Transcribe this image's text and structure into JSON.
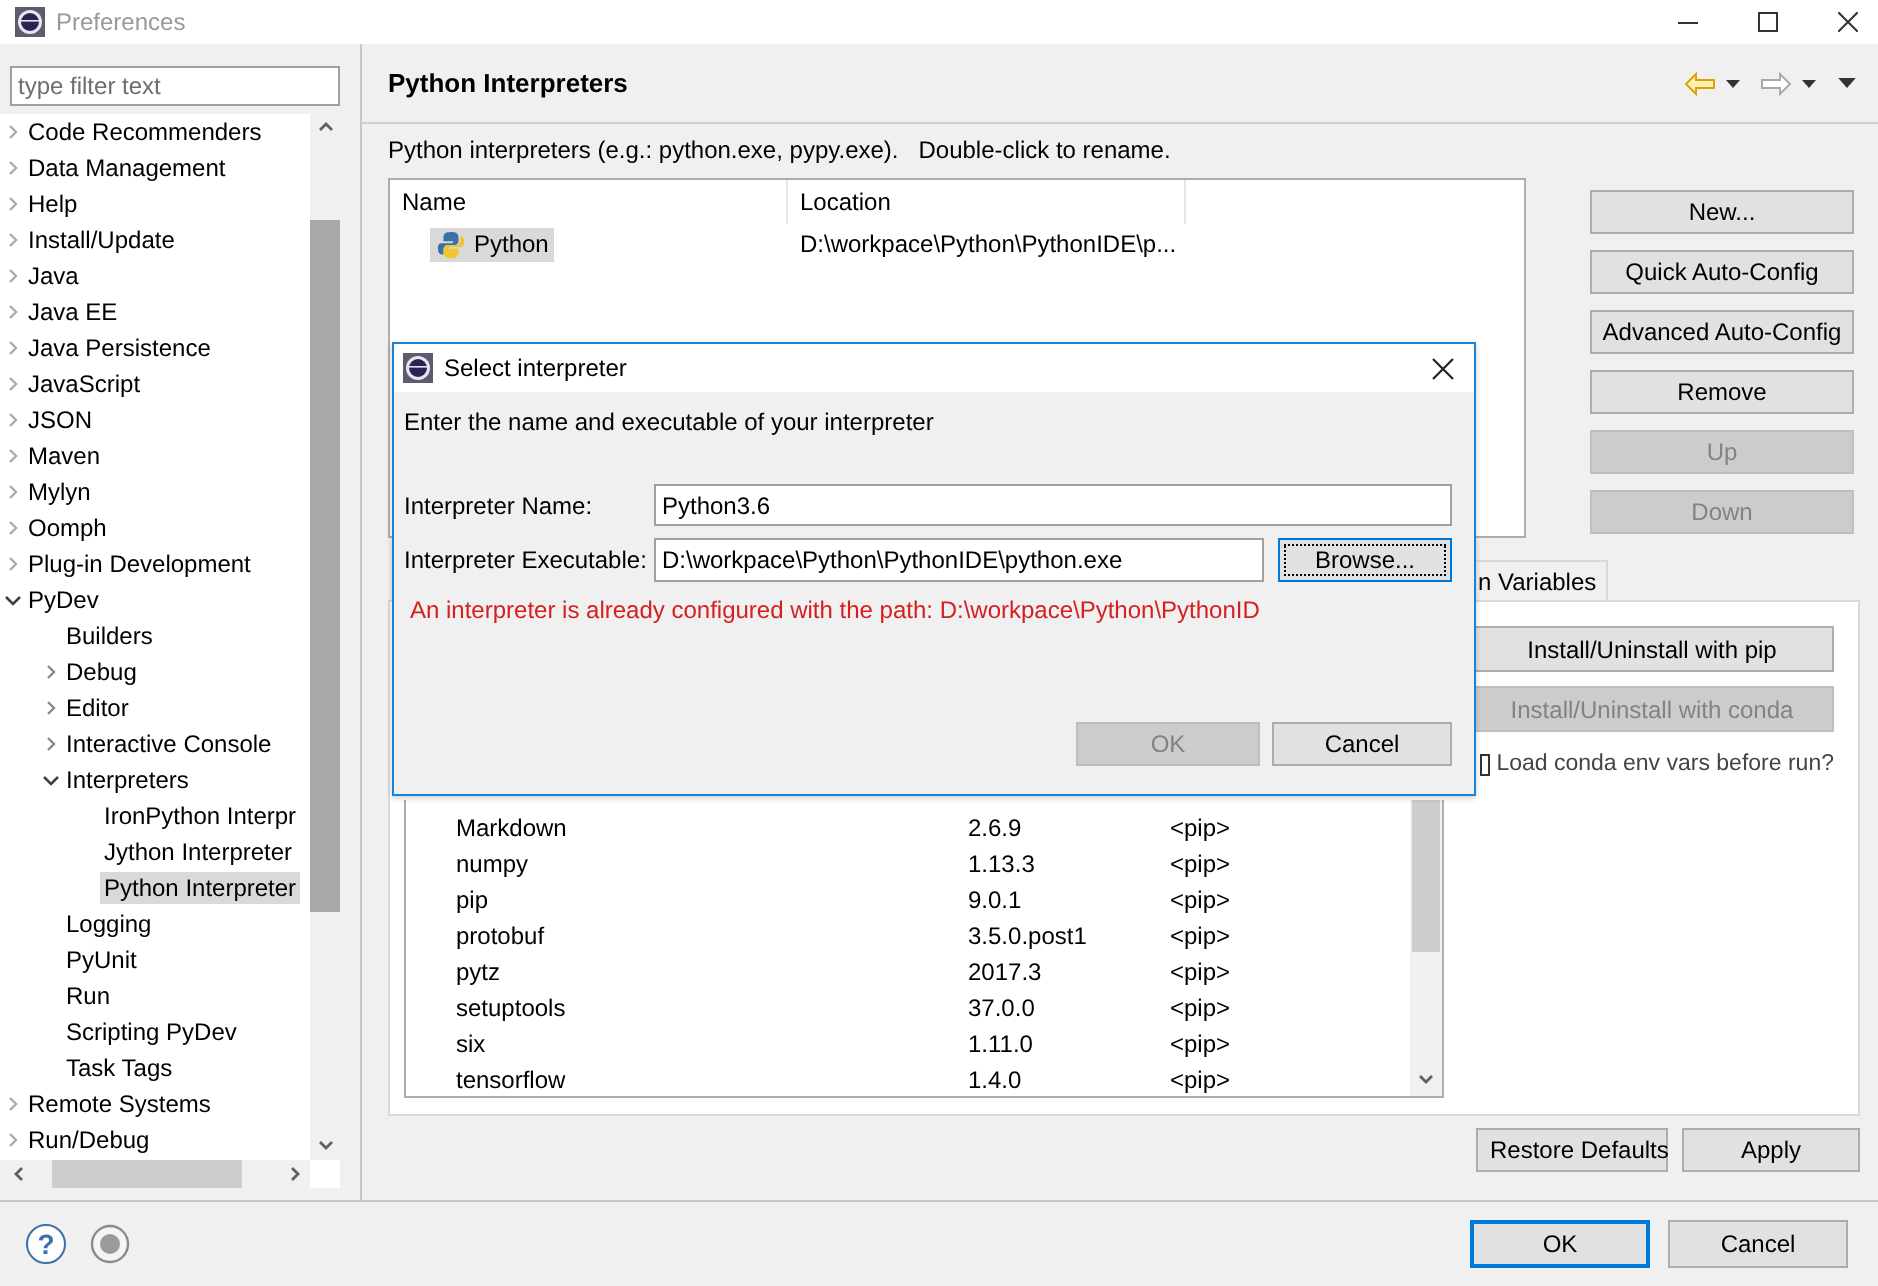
{
  "window": {
    "title": "Preferences"
  },
  "filter": {
    "placeholder": "type filter text"
  },
  "tree": [
    {
      "label": "Code Recommenders",
      "expanded": false,
      "selected": false
    },
    {
      "label": "Data Management",
      "expanded": false,
      "selected": false
    },
    {
      "label": "Help",
      "expanded": false,
      "selected": false
    },
    {
      "label": "Install/Update",
      "expanded": false,
      "selected": false
    },
    {
      "label": "Java",
      "expanded": false,
      "selected": false
    },
    {
      "label": "Java EE",
      "expanded": false,
      "selected": false
    },
    {
      "label": "Java Persistence",
      "expanded": false,
      "selected": false
    },
    {
      "label": "JavaScript",
      "expanded": false,
      "selected": false
    },
    {
      "label": "JSON",
      "expanded": false,
      "selected": false
    },
    {
      "label": "Maven",
      "expanded": false,
      "selected": false
    },
    {
      "label": "Mylyn",
      "expanded": false,
      "selected": false
    },
    {
      "label": "Oomph",
      "expanded": false,
      "selected": false
    },
    {
      "label": "Plug-in Development",
      "expanded": false,
      "selected": false
    },
    {
      "label": "PyDev",
      "expanded": true,
      "selected": false,
      "children": [
        {
          "label": "Builders",
          "selected": false
        },
        {
          "label": "Debug",
          "expanded": false,
          "selected": false
        },
        {
          "label": "Editor",
          "expanded": false,
          "selected": false
        },
        {
          "label": "Interactive Console",
          "expanded": false,
          "selected": false
        },
        {
          "label": "Interpreters",
          "expanded": true,
          "selected": false,
          "children": [
            {
              "label": "IronPython Interpr",
              "selected": false
            },
            {
              "label": "Jython Interpreter",
              "selected": false
            },
            {
              "label": "Python Interpreter",
              "selected": true
            }
          ]
        },
        {
          "label": "Logging",
          "selected": false
        },
        {
          "label": "PyUnit",
          "selected": false
        },
        {
          "label": "Run",
          "selected": false
        },
        {
          "label": "Scripting PyDev",
          "selected": false
        },
        {
          "label": "Task Tags",
          "selected": false
        }
      ]
    },
    {
      "label": "Remote Systems",
      "expanded": false,
      "selected": false
    },
    {
      "label": "Run/Debug",
      "expanded": false,
      "selected": false
    }
  ],
  "page": {
    "title": "Python Interpreters",
    "description": "Python interpreters (e.g.: python.exe, pypy.exe).   Double-click to rename."
  },
  "interpreters": {
    "columns": [
      "Name",
      "Location"
    ],
    "rows": [
      {
        "name": "Python",
        "location": "D:\\workpace\\Python\\PythonIDE\\p...",
        "selected": true
      }
    ]
  },
  "side_buttons": [
    {
      "label": "New...",
      "disabled": false
    },
    {
      "label": "Quick Auto-Config",
      "disabled": false
    },
    {
      "label": "Advanced Auto-Config",
      "disabled": false
    },
    {
      "label": "Remove",
      "disabled": false
    },
    {
      "label": "Up",
      "disabled": true
    },
    {
      "label": "Down",
      "disabled": true
    }
  ],
  "tabs": [
    {
      "label": "n Variables",
      "selected": false
    }
  ],
  "packages": [
    {
      "name": "Markdown",
      "version": "2.6.9",
      "source": "<pip>"
    },
    {
      "name": "numpy",
      "version": "1.13.3",
      "source": "<pip>"
    },
    {
      "name": "pip",
      "version": "9.0.1",
      "source": "<pip>"
    },
    {
      "name": "protobuf",
      "version": "3.5.0.post1",
      "source": "<pip>"
    },
    {
      "name": "pytz",
      "version": "2017.3",
      "source": "<pip>"
    },
    {
      "name": "setuptools",
      "version": "37.0.0",
      "source": "<pip>"
    },
    {
      "name": "six",
      "version": "1.11.0",
      "source": "<pip>"
    },
    {
      "name": "tensorflow",
      "version": "1.4.0",
      "source": "<pip>"
    }
  ],
  "package_actions": [
    {
      "label": "Install/Uninstall with pip",
      "disabled": false
    },
    {
      "label": "Install/Uninstall with conda",
      "disabled": true
    }
  ],
  "conda_option": {
    "label": "Load conda env vars before run?",
    "checked": false
  },
  "page_buttons": [
    {
      "label": "Restore Defaults"
    },
    {
      "label": "Apply"
    }
  ],
  "footer": {
    "help": "?",
    "buttons": [
      {
        "label": "OK",
        "default": true
      },
      {
        "label": "Cancel",
        "default": false
      }
    ]
  },
  "dialog": {
    "title": "Select interpreter",
    "message": "Enter the name and executable of your interpreter",
    "fields": [
      {
        "label": "Interpreter Name:",
        "value": "Python3.6"
      },
      {
        "label": "Interpreter Executable:",
        "value": "D:\\workpace\\Python\\PythonIDE\\python.exe"
      }
    ],
    "browse": {
      "label": "Browse...",
      "focused": true
    },
    "error": "An interpreter is already configured with the path: D:\\workpace\\Python\\PythonID",
    "buttons": [
      {
        "label": "OK",
        "disabled": true
      },
      {
        "label": "Cancel",
        "disabled": false
      }
    ]
  }
}
